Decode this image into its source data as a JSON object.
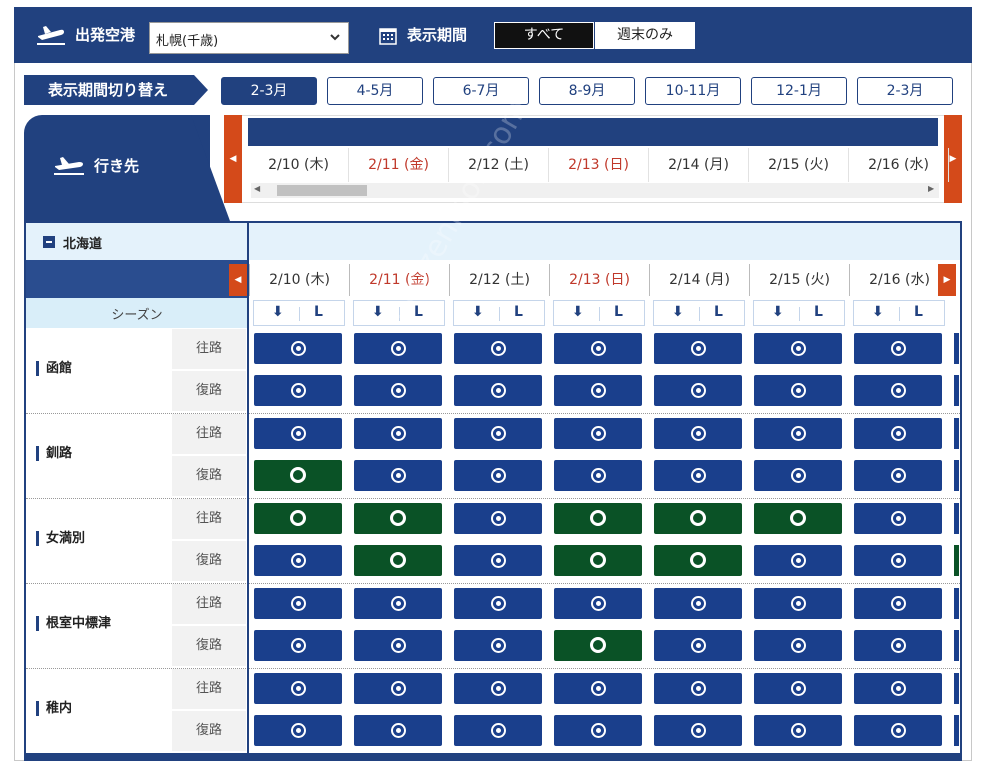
{
  "header": {
    "departure_label": "出発空港",
    "departure_value": "札幌(千歳)",
    "period_label": "表示期間",
    "filter_all": "すべて",
    "filter_weekend": "週末のみ"
  },
  "period_switch": {
    "label": "表示期間切り替え",
    "options": [
      "2-3月",
      "4-5月",
      "6-7月",
      "8-9月",
      "10-11月",
      "12-1月",
      "2-3月"
    ],
    "active_index": 0
  },
  "destination_header": "行き先",
  "dates": [
    {
      "label": "2/10 (木)",
      "holiday": false
    },
    {
      "label": "2/11 (金)",
      "holiday": true
    },
    {
      "label": "2/12 (土)",
      "holiday": false
    },
    {
      "label": "2/13 (日)",
      "holiday": true
    },
    {
      "label": "2/14 (月)",
      "holiday": false
    },
    {
      "label": "2/15 (火)",
      "holiday": false
    },
    {
      "label": "2/16 (水)",
      "holiday": false
    }
  ],
  "region": "北海道",
  "season_label": "シーズン",
  "season_icons": {
    "down": "⬇",
    "l": "L"
  },
  "direction_labels": {
    "outbound": "往路",
    "return": "復路"
  },
  "destinations": [
    {
      "name": "函館",
      "outbound": [
        "available",
        "available",
        "available",
        "available",
        "available",
        "available",
        "available"
      ],
      "return": [
        "available",
        "available",
        "available",
        "available",
        "available",
        "available",
        "available"
      ]
    },
    {
      "name": "釧路",
      "outbound": [
        "available",
        "available",
        "available",
        "available",
        "available",
        "available",
        "available"
      ],
      "return": [
        "few",
        "available",
        "available",
        "available",
        "available",
        "available",
        "available"
      ]
    },
    {
      "name": "女満別",
      "outbound": [
        "few",
        "few",
        "available",
        "few",
        "few",
        "few",
        "available"
      ],
      "return": [
        "available",
        "few",
        "available",
        "few",
        "few",
        "available",
        "available"
      ]
    },
    {
      "name": "根室中標津",
      "outbound": [
        "available",
        "available",
        "available",
        "available",
        "available",
        "available",
        "available"
      ],
      "return": [
        "available",
        "available",
        "available",
        "few",
        "available",
        "available",
        "available"
      ]
    },
    {
      "name": "稚内",
      "outbound": [
        "available",
        "available",
        "available",
        "available",
        "available",
        "available",
        "available"
      ],
      "return": [
        "available",
        "available",
        "available",
        "available",
        "available",
        "available",
        "available"
      ]
    }
  ],
  "watermark": "hirezenmon.com",
  "colors": {
    "navy": "#21417f",
    "cell_available": "#1a3f8c",
    "cell_few": "#0a5226",
    "nav_orange": "#d44a1a",
    "holiday_red": "#c0392b"
  },
  "icons": {
    "plane": "airplane-departure-icon",
    "calendar": "calendar-icon",
    "dropdown": "chevron-down-icon"
  }
}
